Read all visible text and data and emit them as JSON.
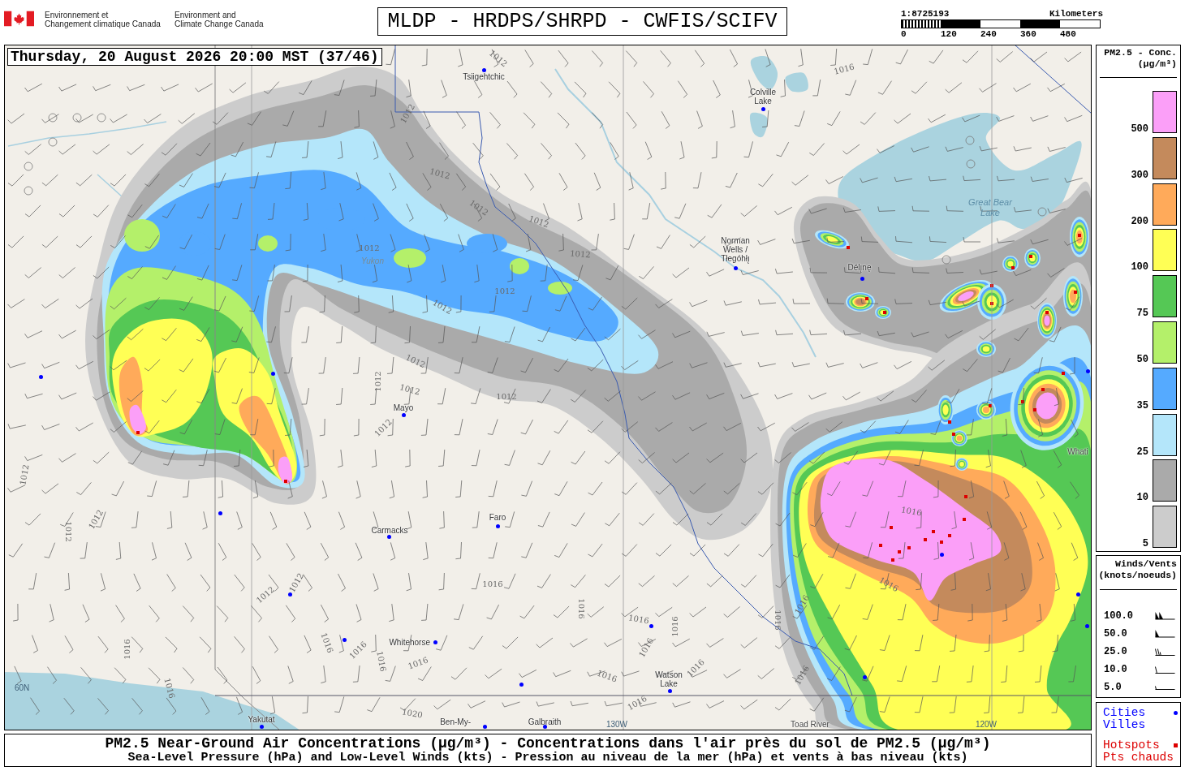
{
  "header": {
    "agencies": [
      {
        "lines": [
          "Environnement et",
          "Changement climatique Canada"
        ]
      },
      {
        "lines": [
          "Environment and",
          "Climate Change Canada"
        ]
      }
    ],
    "title": "MLDP - HRDPS/SHRPD - CWFIS/SCIFV",
    "scale": {
      "ratio": "1:8725193",
      "unit": "Kilometers",
      "ticks": [
        "0",
        "120",
        "240",
        "360",
        "480"
      ]
    }
  },
  "map": {
    "timestamp": "Thursday, 20 August 2026 20:00 MST (37/46)",
    "places": [
      {
        "lines": [
          "Tsiigehtchic"
        ],
        "kind": "city"
      },
      {
        "lines": [
          "Colville",
          "Lake"
        ],
        "kind": "city"
      },
      {
        "lines": [
          "Great Bear",
          "Lake"
        ],
        "kind": "lake"
      },
      {
        "lines": [
          "Norman",
          "Wells /",
          "Tłegóhłı̨"
        ],
        "kind": "city"
      },
      {
        "lines": [
          "Délı̨nę"
        ],
        "kind": "city"
      },
      {
        "lines": [
          "Yukon"
        ],
        "kind": "river"
      },
      {
        "lines": [
          "Mayo"
        ],
        "kind": "city"
      },
      {
        "lines": [
          "Whati"
        ],
        "kind": "label"
      },
      {
        "lines": [
          "Faro"
        ],
        "kind": "city"
      },
      {
        "lines": [
          "Carmacks"
        ],
        "kind": "city"
      },
      {
        "lines": [
          "Whitehorse"
        ],
        "kind": "city"
      },
      {
        "lines": [
          "Watson",
          "Lake"
        ],
        "kind": "city"
      },
      {
        "lines": [
          "Yakutat"
        ],
        "kind": "city"
      },
      {
        "lines": [
          "Ben-My-"
        ],
        "kind": "city"
      },
      {
        "lines": [
          "Galbraith"
        ],
        "kind": "city"
      },
      {
        "lines": [
          "Toad River"
        ],
        "kind": "label"
      }
    ],
    "isobar_labels": [
      "1012",
      "1012",
      "1012",
      "1012",
      "1012",
      "1012",
      "1012",
      "1012",
      "1012",
      "1012",
      "1012",
      "1012",
      "1012",
      "1012",
      "1016",
      "1012",
      "1012",
      "1012",
      "1012",
      "1012",
      "1016",
      "1016",
      "1016",
      "1016",
      "1016",
      "1016",
      "1016",
      "1016",
      "1016",
      "1016",
      "1016",
      "1016",
      "1016",
      "1016",
      "1016",
      "1016",
      "1016",
      "1016",
      "1016",
      "1020"
    ],
    "grid_labels": [
      "60N",
      "130W",
      "120W"
    ]
  },
  "legend": {
    "concentration": {
      "title": "PM2.5 - Conc.",
      "unit": "(µg/m³)",
      "classes": [
        {
          "label": "500",
          "color": "#fb9ff8"
        },
        {
          "label": "300",
          "color": "#c48a5c"
        },
        {
          "label": "200",
          "color": "#ffaa5a"
        },
        {
          "label": "100",
          "color": "#ffff55"
        },
        {
          "label": "75",
          "color": "#55c855"
        },
        {
          "label": "50",
          "color": "#b4f06a"
        },
        {
          "label": "35",
          "color": "#55aaff"
        },
        {
          "label": "25",
          "color": "#b4e6fa"
        },
        {
          "label": "10",
          "color": "#aaaaaa"
        },
        {
          "label": "5",
          "color": "#cccccc"
        }
      ]
    },
    "winds": {
      "title": "Winds/Vents",
      "unit": "(knots/noeuds)",
      "speeds": [
        "100.0",
        "50.0",
        "25.0",
        "10.0",
        "5.0"
      ]
    },
    "markers": [
      {
        "kind": "city",
        "lines": [
          "Cities",
          "Villes"
        ],
        "color": "#0000ff"
      },
      {
        "kind": "hotspot",
        "lines": [
          "Hotspots",
          "Pts chauds"
        ],
        "color": "#dd0000"
      }
    ]
  },
  "footer": {
    "title": "PM2.5 Near-Ground Air Concentrations (µg/m³) - Concentrations dans l'air près du sol de PM2.5 (µg/m³)",
    "subtitle": "Sea-Level Pressure (hPa) and Low-Level Winds (kts) - Pression au niveau de la mer (hPa) et vents à bas niveau (kts)"
  }
}
